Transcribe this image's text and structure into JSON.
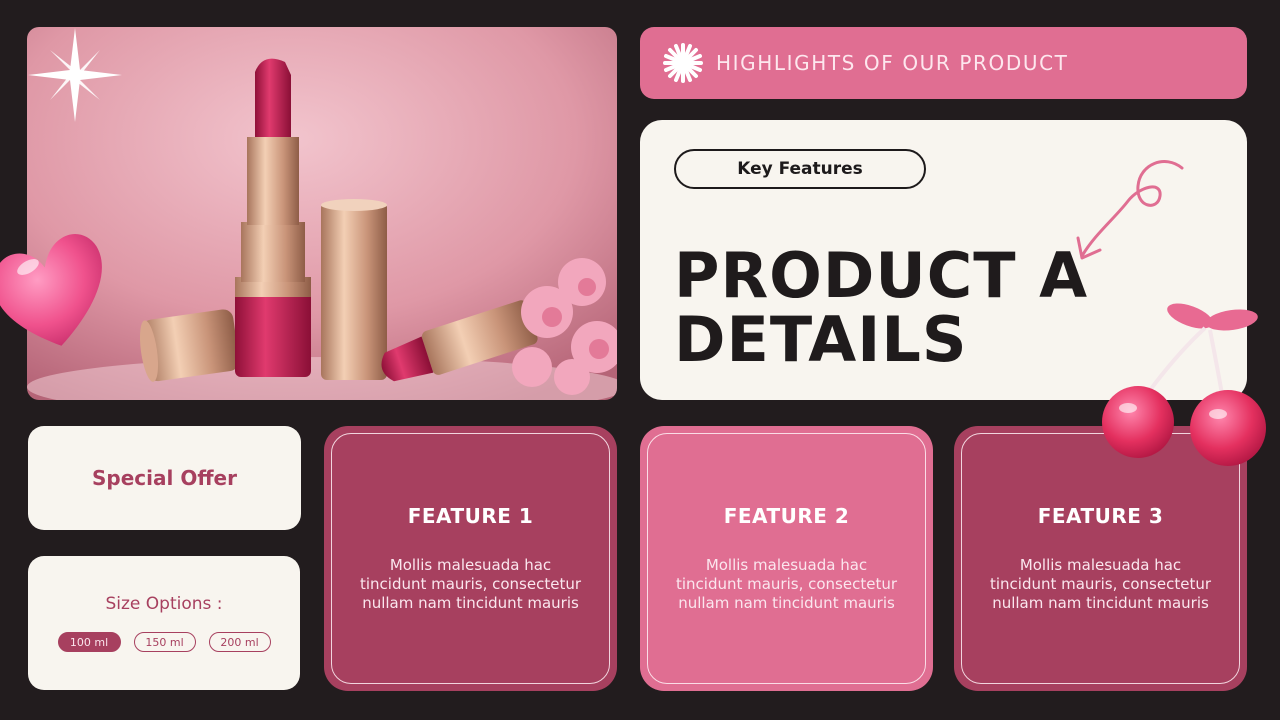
{
  "header": {
    "highlights_label": "HIGHLIGHTS OF OUR PRODUCT"
  },
  "details": {
    "pill_label": "Key Features",
    "title_line1": "PRODUCT A",
    "title_line2": "DETAILS"
  },
  "offer": {
    "label": "Special Offer"
  },
  "sizes": {
    "label": "Size Options :",
    "options": [
      "100 ml",
      "150 ml",
      "200 ml"
    ],
    "selected": "100 ml"
  },
  "features": [
    {
      "title": "FEATURE 1",
      "description": "Mollis malesuada hac tincidunt mauris, consectetur nullam nam tincidunt mauris"
    },
    {
      "title": "FEATURE 2",
      "description": "Mollis malesuada hac tincidunt mauris, consectetur nullam nam tincidunt mauris"
    },
    {
      "title": "FEATURE 3",
      "description": "Mollis malesuada hac tincidunt mauris, consectetur nullam nam tincidunt mauris"
    }
  ],
  "colors": {
    "background": "#221c1e",
    "berry": "#a7405f",
    "pink": "#e06e92",
    "cream": "#f8f5ef"
  },
  "icons": [
    "sparkle-icon",
    "burst-icon",
    "swirl-arrow-icon",
    "heart-decoration",
    "cherry-decoration"
  ]
}
